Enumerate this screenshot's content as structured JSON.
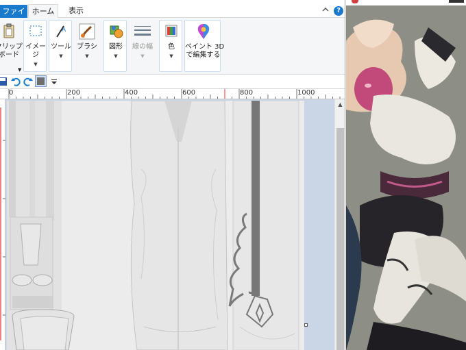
{
  "ribbon": {
    "tabs": [
      {
        "label": "ファイル"
      },
      {
        "label": "ホーム"
      },
      {
        "label": "表示"
      }
    ],
    "help_label": "?",
    "groups": {
      "clipboard": {
        "label": "クリップ\nボード"
      },
      "image": {
        "label": "イメージ"
      },
      "tools": {
        "label": "ツール"
      },
      "brush": {
        "label": "ブラシ"
      },
      "shapes": {
        "label": "図形"
      },
      "line_width": {
        "label": "線の幅"
      },
      "colors": {
        "label": "色"
      },
      "paint3d": {
        "label": "ペイント 3D\nで編集する"
      }
    }
  },
  "ruler": {
    "labels": [
      "0",
      "200",
      "400",
      "600",
      "800",
      "1000"
    ]
  },
  "colors": {
    "accent": "#1979ca",
    "ruler_marker": "#e03030",
    "workspace": "#cad6e6",
    "canvas": "#ececec"
  },
  "icons": {
    "save": "save-icon",
    "undo": "undo-icon",
    "redo": "redo-icon",
    "customize": "customize-qat-icon"
  }
}
